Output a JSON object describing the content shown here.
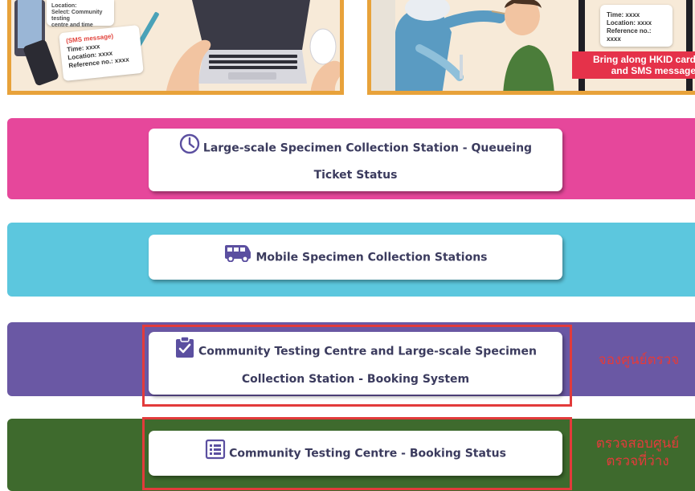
{
  "illustration_left": {
    "card_lines": [
      "Location:",
      "Select: Community testing",
      "centre and time"
    ],
    "sms_title": "(SMS message)",
    "sms_lines": [
      "Time: xxxx",
      "Location: xxxx",
      "Reference no.: xxxx"
    ]
  },
  "illustration_right": {
    "sms_lines": [
      "Time: xxxx",
      "Location: xxxx",
      "Reference no.: xxxx"
    ],
    "banner_lines": [
      "Bring along HKID card",
      "and SMS message"
    ]
  },
  "menu": {
    "queue_status_lines": [
      "Large-scale Specimen Collection Station - Queueing",
      "Ticket Status"
    ],
    "mobile_stations": "Mobile Specimen Collection Stations",
    "booking_system_lines": [
      "Community Testing Centre and Large-scale Specimen",
      "Collection Station - Booking System"
    ],
    "booking_status": "Community Testing Centre - Booking Status"
  },
  "annotations": {
    "booking_note": "จองศูนย์ตรวจ",
    "status_note_lines": [
      "ตรวจสอบศูนย์",
      "ตรวจที่ว่าง"
    ]
  },
  "icons": {
    "queue": "clock-icon",
    "mobile": "van-icon",
    "booking": "clipboard-check-icon",
    "status": "list-icon"
  },
  "colors": {
    "pink_band": "#e6479b",
    "cyan_band": "#5cc7de",
    "purple_band": "#6a58a4",
    "green_band": "#3e6a2d",
    "icon_purple": "#5b4fa0",
    "annotation_red": "#e23b3b"
  }
}
